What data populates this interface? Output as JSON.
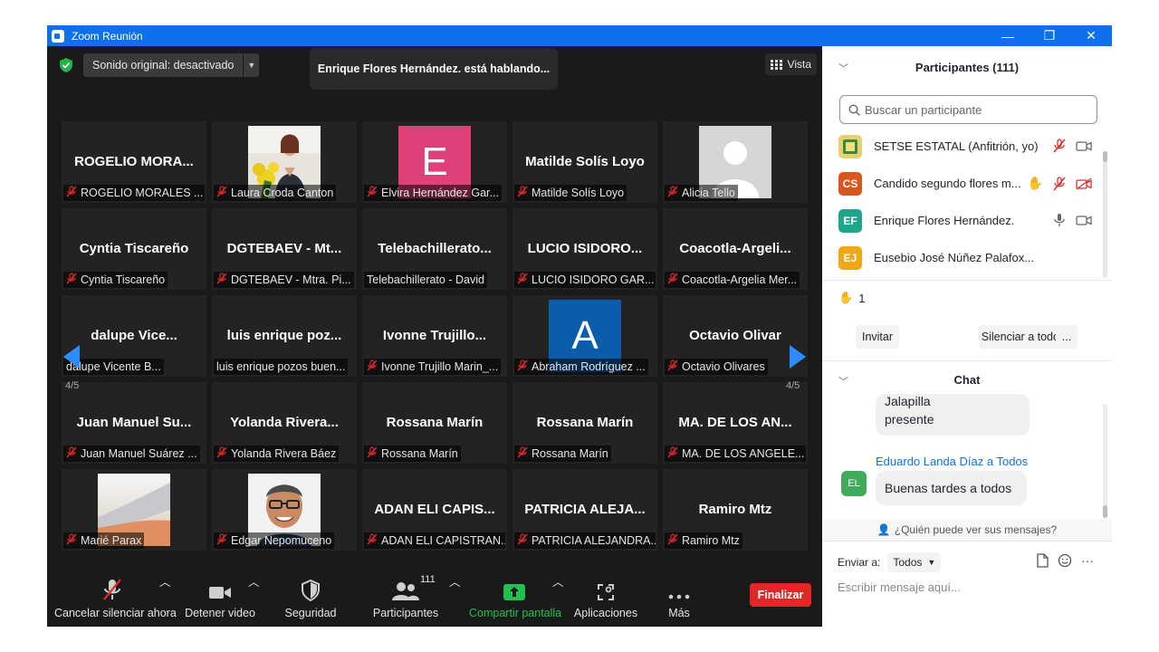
{
  "window": {
    "title": "Zoom Reunión",
    "minimize": "—",
    "restore": "❐",
    "close": "✕"
  },
  "topbar": {
    "sound_label": "Sonido original: desactivado",
    "speaking": "Enrique Flores Hernández. está hablando...",
    "view_label": "Vista"
  },
  "gallery": {
    "page_left": "4/5",
    "page_right": "4/5",
    "tiles": [
      {
        "big": "ROGELIO  MORA...",
        "cap": "ROGELIO MORALES ...",
        "muted": true
      },
      {
        "big": "",
        "cap": "Laura Croda Canton",
        "muted": true
      },
      {
        "big": "",
        "cap": "Elvira Hernández Gar...",
        "muted": true,
        "letter": "E",
        "color": "#e0407a"
      },
      {
        "big": "Matilde Solís Loyo",
        "cap": "Matilde Solís Loyo",
        "muted": true
      },
      {
        "big": "",
        "cap": "Alicia Tello",
        "muted": true
      },
      {
        "big": "Cyntia Tiscareño",
        "cap": "Cyntia Tiscareño",
        "muted": true
      },
      {
        "big": "DGTEBAEV - Mt...",
        "cap": "DGTEBAEV - Mtra. Pi...",
        "muted": true
      },
      {
        "big": "Telebachillerato...",
        "cap": "Telebachillerato - David",
        "muted": false
      },
      {
        "big": "LUCIO  ISIDORO...",
        "cap": "LUCIO ISIDORO GAR...",
        "muted": true
      },
      {
        "big": "Coacotla-Argeli...",
        "cap": "Coacotla-Argelia Mer...",
        "muted": true
      },
      {
        "big": "dalupe  Vice...",
        "cap": "dalupe Vicente B...",
        "muted": false
      },
      {
        "big": "luis  enrique  poz...",
        "cap": "luis enrique pozos buen...",
        "muted": false
      },
      {
        "big": "Ivonne  Trujillo...",
        "cap": "Ivonne Trujillo Marin_...",
        "muted": true
      },
      {
        "big": "",
        "cap": "Abraham Rodríguez ...",
        "muted": true,
        "letter": "A",
        "color": "#0b5cab"
      },
      {
        "big": "Octavio  Olivar",
        "cap": "Octavio Olivares",
        "muted": true
      },
      {
        "big": "Juan  Manuel  Su...",
        "cap": "Juan Manuel Suárez ...",
        "muted": true
      },
      {
        "big": "Yolanda  Rivera...",
        "cap": "Yolanda Rivera Báez",
        "muted": true
      },
      {
        "big": "Rossana  Marín",
        "cap": "Rossana Marín",
        "muted": true
      },
      {
        "big": "Rossana  Marín",
        "cap": "Rossana Marín",
        "muted": true
      },
      {
        "big": "MA.  DE  LOS  AN...",
        "cap": "MA. DE LOS ANGELE...",
        "muted": true
      },
      {
        "big": "",
        "cap": "Marié Parax",
        "muted": true
      },
      {
        "big": "",
        "cap": "Edgar Nepomuceno",
        "muted": true
      },
      {
        "big": "ADAN  ELI  CAPIS...",
        "cap": "ADAN ELI CAPISTRAN...",
        "muted": true
      },
      {
        "big": "PATRICIA  ALEJA...",
        "cap": "PATRICIA ALEJANDRA...",
        "muted": true
      },
      {
        "big": "Ramiro  Mtz",
        "cap": "Ramiro Mtz",
        "muted": true
      }
    ]
  },
  "toolbar": {
    "unmute": "Cancelar silenciar ahora",
    "video": "Detener video",
    "security": "Seguridad",
    "participants": "Participantes",
    "participants_count": "111",
    "share": "Compartir pantalla",
    "apps": "Aplicaciones",
    "more": "Más",
    "end": "Finalizar"
  },
  "participants_panel": {
    "title": "Participantes (111)",
    "search_placeholder": "Buscar un participante",
    "rows": [
      {
        "initials": "",
        "name": "SETSE ESTATAL (Anfitrión, yo)",
        "color": "#e8d070"
      },
      {
        "initials": "CS",
        "name": "Candido segundo flores m...",
        "color": "#d9571f"
      },
      {
        "initials": "EF",
        "name": "Enrique Flores Hernández.",
        "color": "#1fa58a"
      },
      {
        "initials": "EJ",
        "name": "Eusebio José Núñez Palafox...",
        "color": "#f0a818"
      }
    ],
    "raised_hands": "1",
    "invite": "Invitar",
    "mute_all": "Silenciar a todos",
    "more": "..."
  },
  "chat": {
    "title": "Chat",
    "prev_msg_line1": "Jalapilla",
    "prev_msg_line2": "presente",
    "sender": "Eduardo Landa Díaz a Todos",
    "sender_initials": "EL",
    "message": "Buenas tardes a todos",
    "who_can_see": "¿Quién puede ver sus mensajes?",
    "send_to_label": "Enviar a:",
    "send_to_value": "Todos",
    "input_placeholder": "Escribir mensaje aquí..."
  }
}
